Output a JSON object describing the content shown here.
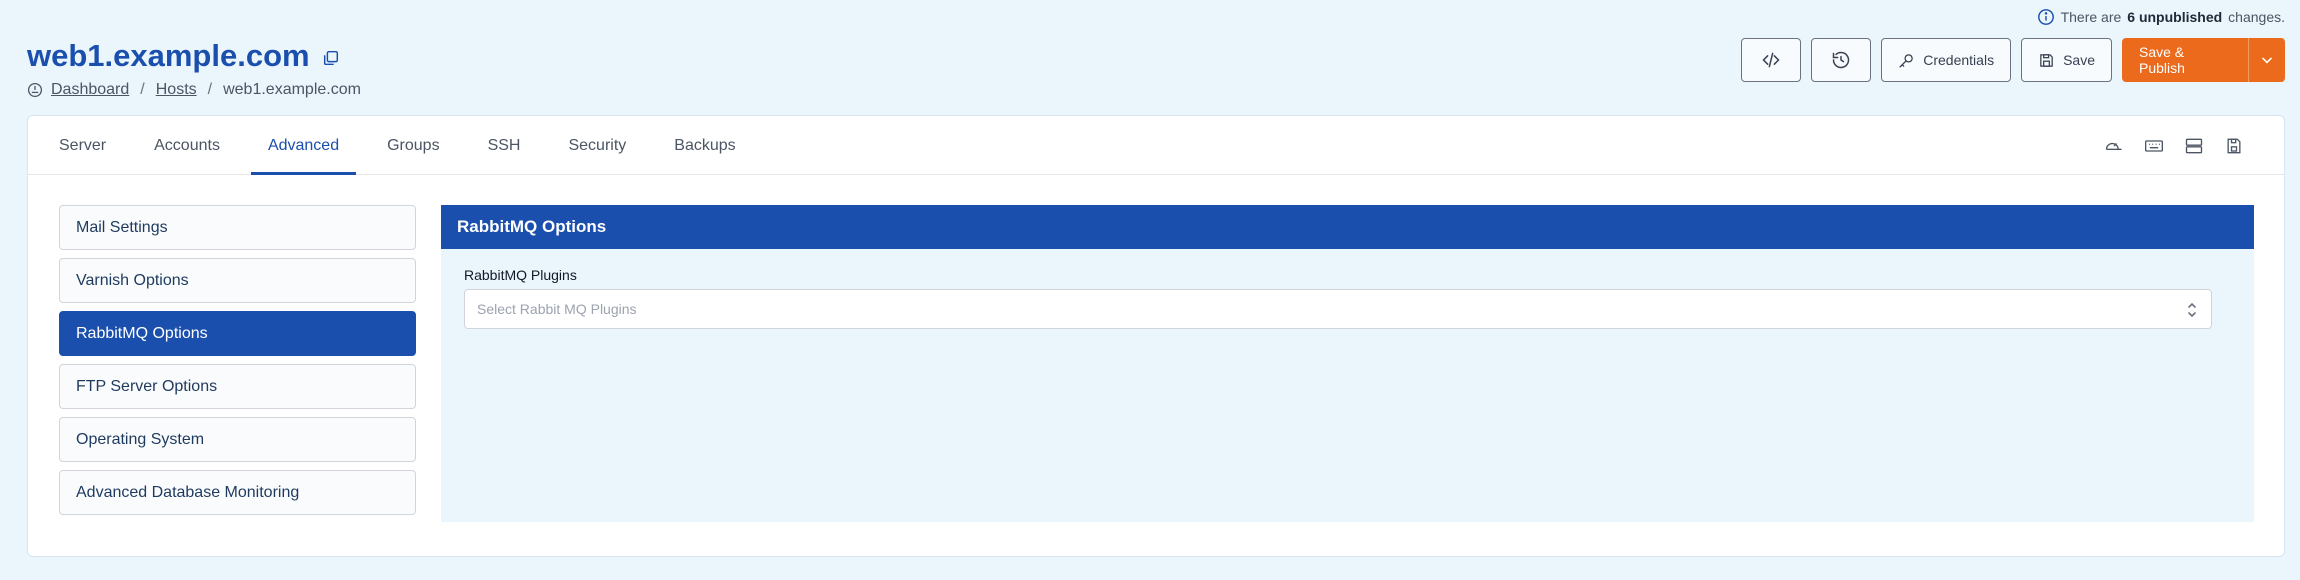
{
  "notice": {
    "prefix": "There are",
    "count_text": "6 unpublished",
    "suffix": "changes."
  },
  "header": {
    "title": "web1.example.com",
    "breadcrumb": {
      "dashboard": "Dashboard",
      "hosts": "Hosts",
      "current": "web1.example.com"
    }
  },
  "actions": {
    "credentials": "Credentials",
    "save": "Save",
    "publish": "Save & Publish"
  },
  "tabs": [
    "Server",
    "Accounts",
    "Advanced",
    "Groups",
    "SSH",
    "Security",
    "Backups"
  ],
  "active_tab": "Advanced",
  "sidebar": {
    "items": [
      "Mail Settings",
      "Varnish Options",
      "RabbitMQ Options",
      "FTP Server Options",
      "Operating System",
      "Advanced Database Monitoring"
    ],
    "active": "RabbitMQ Options"
  },
  "panel": {
    "title": "RabbitMQ Options",
    "field_label": "RabbitMQ Plugins",
    "placeholder": "Select Rabbit MQ Plugins"
  },
  "colors": {
    "primary": "#1a4fae",
    "accent": "#ec6a1b",
    "background": "#eaf5fc"
  }
}
